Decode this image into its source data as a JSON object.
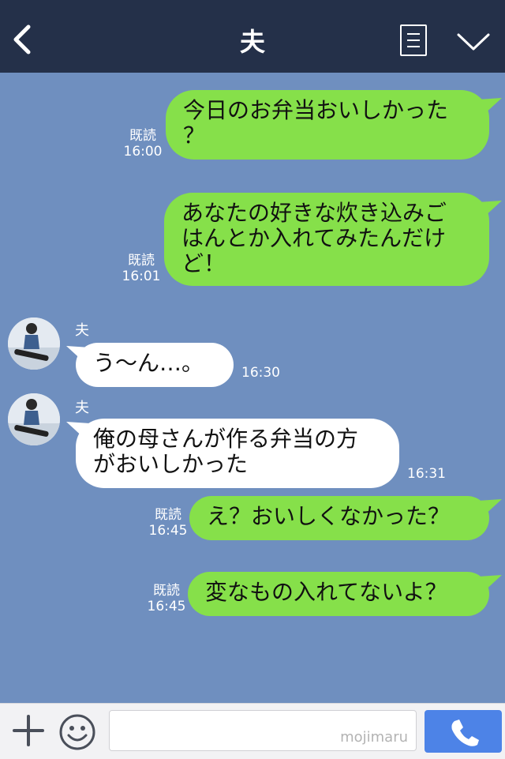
{
  "header": {
    "title": "夫",
    "back_icon": "chevron-left-icon",
    "note_icon": "note-icon",
    "menu_icon": "chevron-down-icon"
  },
  "messages": [
    {
      "from": "me",
      "text": "今日のお弁当おいしかった\n？",
      "read": "既読",
      "time": "16:00"
    },
    {
      "from": "me",
      "text": "あなたの好きな炊き込みご\nはんとか入れてみたんだけ\nど！",
      "read": "既読",
      "time": "16:01"
    },
    {
      "from": "friend",
      "name": "夫",
      "text": "う～ん…。",
      "time": "16:30"
    },
    {
      "from": "friend",
      "name": "夫",
      "text": "俺の母さんが作る弁当の方\nがおいしかった",
      "time": "16:31"
    },
    {
      "from": "me",
      "text": "え？おいしくなかった？",
      "read": "既読",
      "time": "16:45"
    },
    {
      "from": "me",
      "text": "変なもの入れてないよ？",
      "read": "既読",
      "time": "16:45"
    }
  ],
  "footer": {
    "plus_icon": "plus-icon",
    "emoji_icon": "smile-icon",
    "input_value": "",
    "watermark": "mojimaru",
    "call_icon": "phone-icon"
  },
  "colors": {
    "background": "#6f8fbf",
    "header": "#243049",
    "me_bubble": "#86e04a",
    "friend_bubble": "#ffffff",
    "call_button": "#4d83e7"
  }
}
